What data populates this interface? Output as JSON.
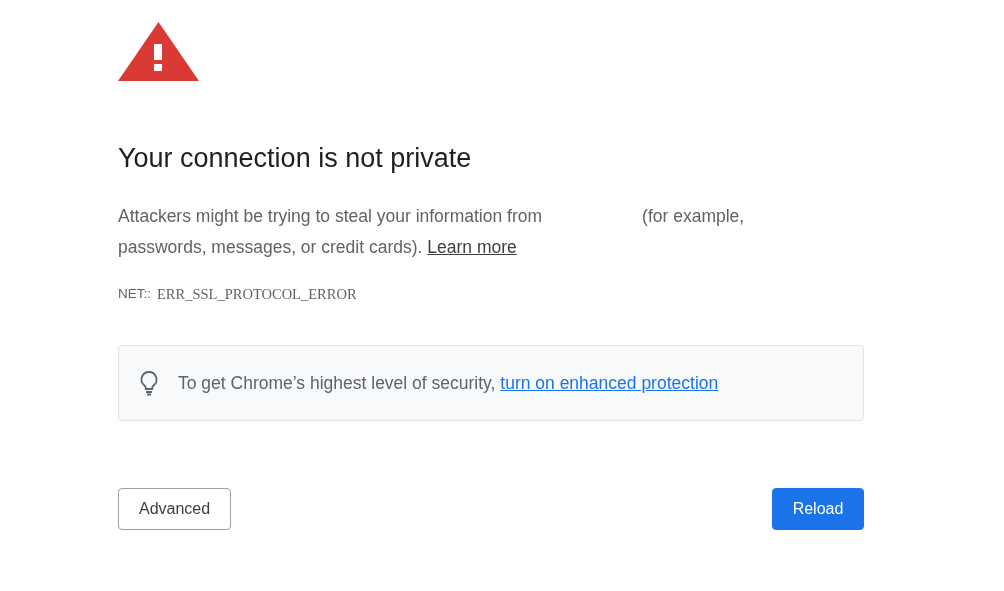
{
  "heading": "Your connection is not private",
  "description": {
    "text_before_gap": "Attackers might be trying to steal your information from",
    "text_after_gap": "(for example, passwords, messages, or credit cards).",
    "link": "Learn more"
  },
  "error_code": {
    "prefix": "NET::",
    "code": "ERR_SSL_PROTOCOL_ERROR"
  },
  "tip": {
    "text": "To get Chrome’s highest level of security,",
    "link": "turn on enhanced protection"
  },
  "buttons": [
    {
      "label": "Advanced",
      "kind": "secondary"
    },
    {
      "label": "Reload",
      "kind": "primary"
    }
  ]
}
